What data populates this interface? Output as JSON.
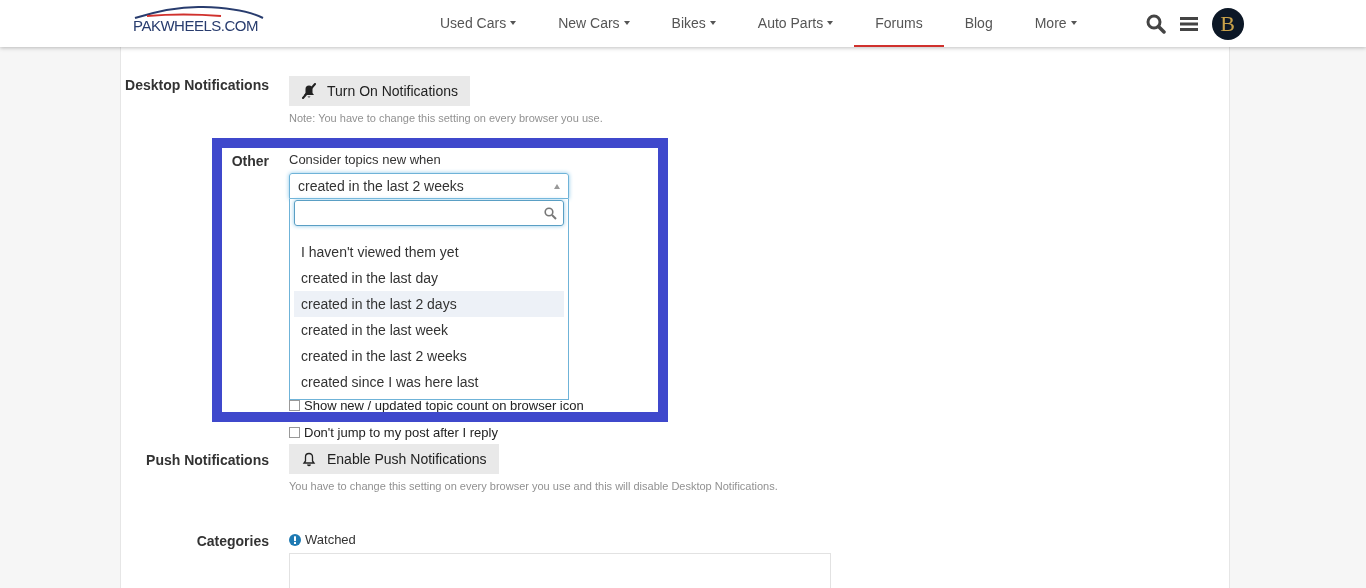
{
  "header": {
    "logo": "PAKWHEELS.COM",
    "nav": [
      {
        "label": "Used Cars",
        "dropdown": true,
        "selected": false
      },
      {
        "label": "New Cars",
        "dropdown": true,
        "selected": false
      },
      {
        "label": "Bikes",
        "dropdown": true,
        "selected": false
      },
      {
        "label": "Auto Parts",
        "dropdown": true,
        "selected": false
      },
      {
        "label": "Forums",
        "dropdown": false,
        "selected": true
      },
      {
        "label": "Blog",
        "dropdown": false,
        "selected": false
      },
      {
        "label": "More",
        "dropdown": true,
        "selected": false
      }
    ],
    "avatar_letter": "B"
  },
  "desktop_notifications": {
    "label": "Desktop Notifications",
    "button": "Turn On Notifications",
    "note": "Note: You have to change this setting on every browser you use."
  },
  "other": {
    "label": "Other",
    "field_label": "Consider topics new when",
    "value": "created in the last 2 weeks",
    "dropdown": {
      "expanded": true,
      "options": [
        {
          "label": "I haven't viewed them yet",
          "selected": false
        },
        {
          "label": "created in the last day",
          "selected": false
        },
        {
          "label": "created in the last 2 days",
          "selected": true
        },
        {
          "label": "created in the last week",
          "selected": false
        },
        {
          "label": "created in the last 2 weeks",
          "selected": false
        },
        {
          "label": "created since I was here last",
          "selected": false
        }
      ]
    },
    "checkboxes": [
      {
        "label": "Show new / updated topic count on browser icon",
        "checked": false
      },
      {
        "label": "Don't jump to my post after I reply",
        "checked": false
      }
    ]
  },
  "push_notifications": {
    "label": "Push Notifications",
    "button": "Enable Push Notifications",
    "note": "You have to change this setting on every browser you use and this will disable Desktop Notifications."
  },
  "categories": {
    "label": "Categories",
    "watched": "Watched"
  }
}
